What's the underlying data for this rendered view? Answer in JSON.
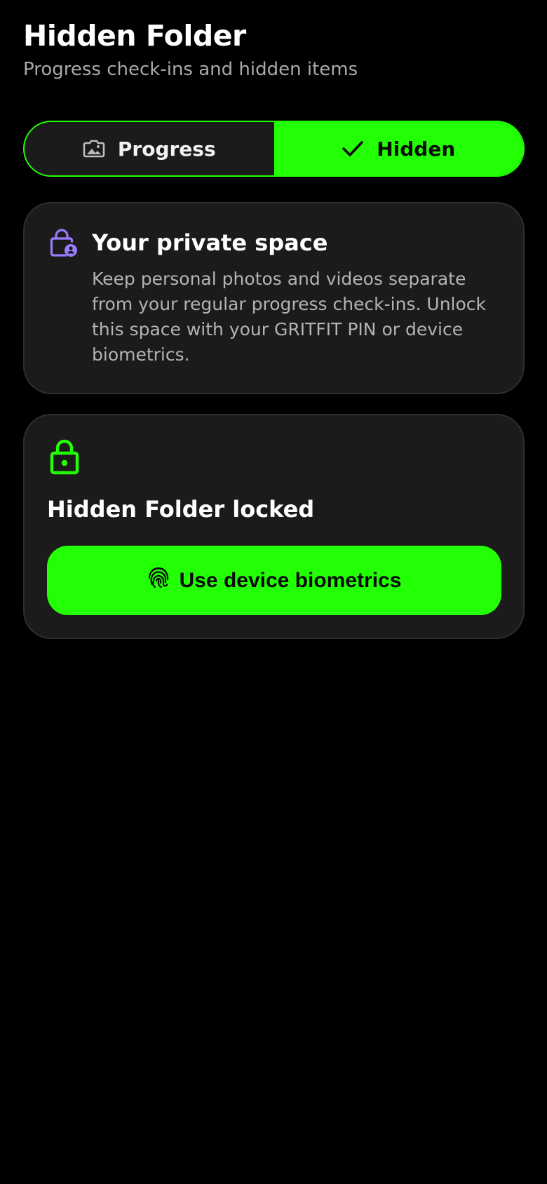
{
  "header": {
    "title": "Hidden Folder",
    "subtitle": "Progress check-ins and hidden items"
  },
  "tabs": [
    {
      "label": "Progress",
      "icon": "image-icon",
      "selected": false
    },
    {
      "label": "Hidden",
      "icon": "check-icon",
      "selected": true
    }
  ],
  "info_card": {
    "icon": "lock-person-icon",
    "title": "Your private space",
    "text": "Keep personal photos and videos separate from your regular progress check-ins. Unlock this space with your GRITFIT PIN or device biometrics."
  },
  "lock_card": {
    "icon": "lock-icon",
    "title": "Hidden Folder locked",
    "button_label": "Use device biometrics",
    "button_icon": "fingerprint-icon"
  },
  "colors": {
    "accent": "#23ff05",
    "background": "#000000",
    "card": "#1b1b1c",
    "purple_icon": "#9b7bff",
    "muted_text": "#b3b3b6"
  }
}
